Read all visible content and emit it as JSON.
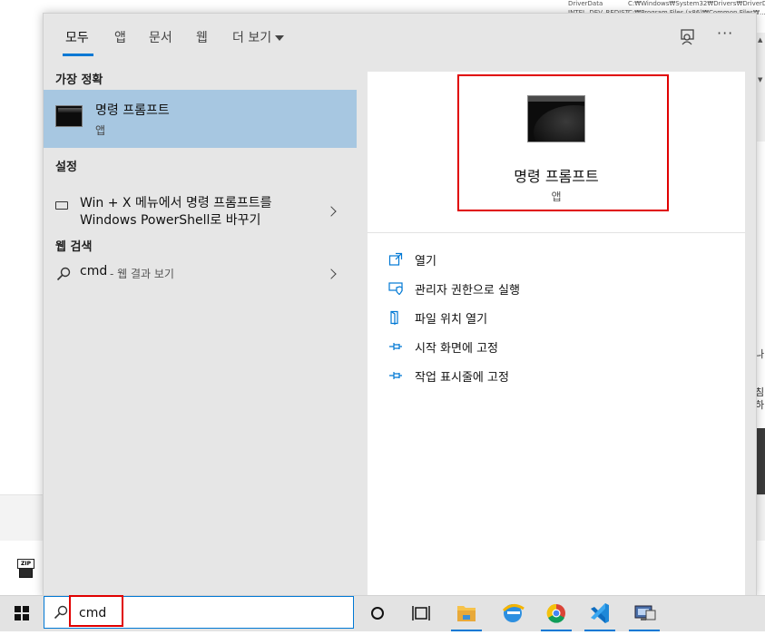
{
  "background": {
    "env_rows": [
      {
        "name": "DriverData",
        "value": "C:₩Windows₩System32₩Drivers₩DriverData"
      },
      {
        "name": "INTEL_DEV_REDIST",
        "value": "C:₩Program Files (x86)₩Common Files₩..."
      }
    ],
    "side_text_1": "나",
    "side_text_2": "침\n하"
  },
  "tabs": [
    {
      "label": "모두",
      "active": true
    },
    {
      "label": "앱"
    },
    {
      "label": "문서"
    },
    {
      "label": "웹"
    },
    {
      "label": "더 보기"
    }
  ],
  "sections": {
    "best_match": "가장 정확",
    "settings": "설정",
    "web_search": "웹 검색"
  },
  "best_match": {
    "name": "명령 프롬프트",
    "type": "앱",
    "icon": "cmd-icon"
  },
  "setting": {
    "line1": "Win + X 메뉴에서 명령 프롬프트를",
    "line2": "Windows PowerShell로 바꾸기",
    "icon": "keyboard-icon"
  },
  "web": {
    "query": "cmd",
    "suffix": "- 웹 결과 보기",
    "icon": "search-icon"
  },
  "preview": {
    "title": "명령 프롬프트",
    "subtitle": "앱"
  },
  "actions": [
    {
      "label": "열기",
      "icon": "open-icon"
    },
    {
      "label": "관리자 권한으로 실행",
      "icon": "admin-shield-icon"
    },
    {
      "label": "파일 위치 열기",
      "icon": "file-location-icon"
    },
    {
      "label": "시작 화면에 고정",
      "icon": "pin-icon"
    },
    {
      "label": "작업 표시줄에 고정",
      "icon": "pin-icon"
    }
  ],
  "search_box": {
    "value": "cmd"
  },
  "colors": {
    "accent": "#0078d4",
    "selected": "#a7c7e1",
    "highlight_box": "#e00000"
  },
  "taskbar_icons": [
    "cortana-icon",
    "task-view-icon",
    "file-explorer-icon",
    "edge-icon",
    "chrome-icon",
    "vscode-icon",
    "remote-desktop-icon"
  ],
  "zip_icon_label": "ZIP"
}
